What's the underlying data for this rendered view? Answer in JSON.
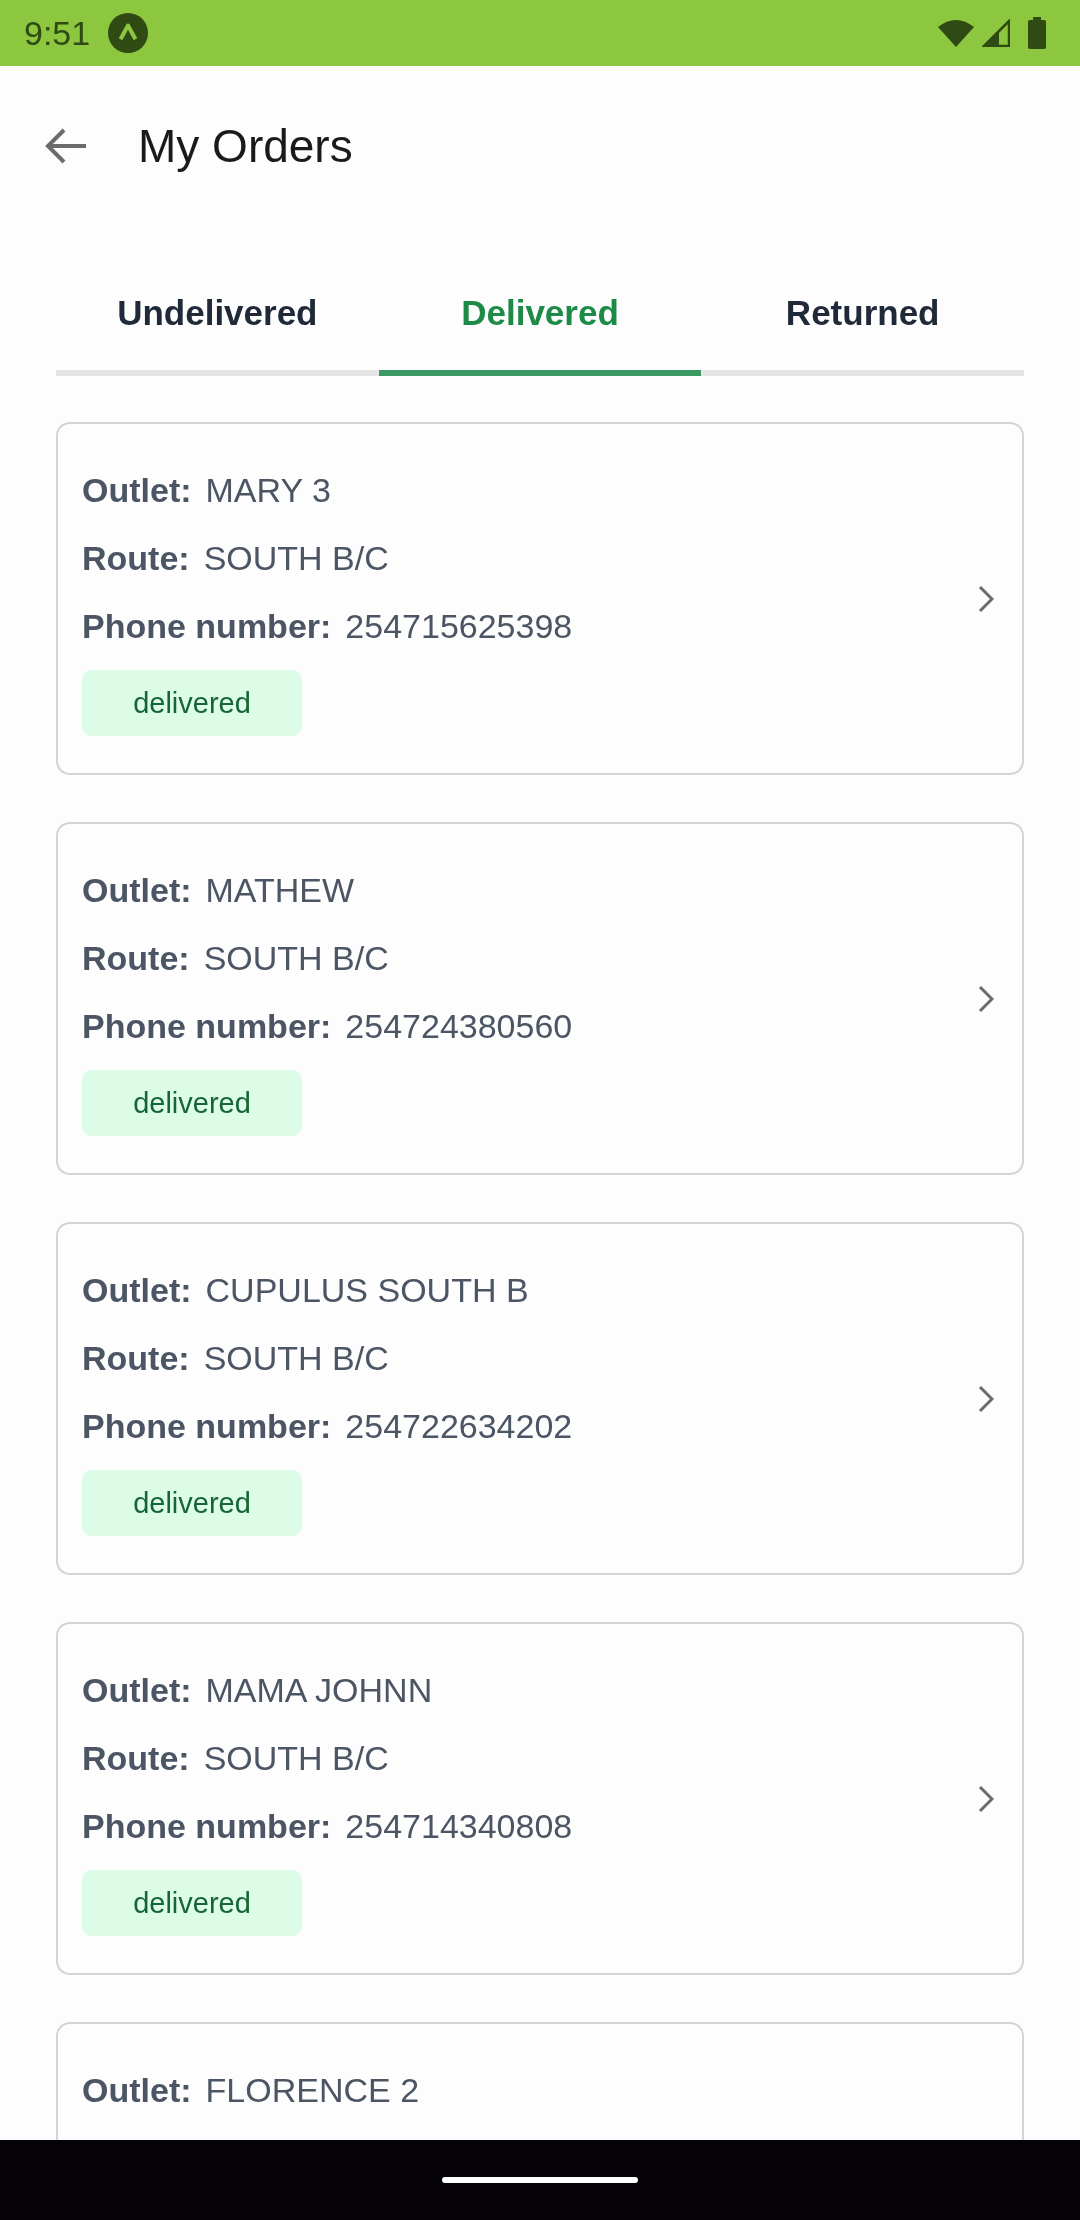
{
  "status_bar": {
    "time": "9:51"
  },
  "header": {
    "title": "My Orders"
  },
  "tabs": [
    {
      "label": "Undelivered",
      "selected": false
    },
    {
      "label": "Delivered",
      "selected": true
    },
    {
      "label": "Returned",
      "selected": false
    }
  ],
  "orders": [
    {
      "fields": [
        {
          "label": "Outlet:",
          "value": "MARY 3"
        },
        {
          "label": "Route:",
          "value": "SOUTH B/C"
        },
        {
          "label": "Phone number:",
          "value": "254715625398"
        }
      ],
      "status": "delivered"
    },
    {
      "fields": [
        {
          "label": "Outlet:",
          "value": "MATHEW"
        },
        {
          "label": "Route:",
          "value": "SOUTH B/C"
        },
        {
          "label": "Phone number:",
          "value": "254724380560"
        }
      ],
      "status": "delivered"
    },
    {
      "fields": [
        {
          "label": "Outlet:",
          "value": "CUPULUS SOUTH B"
        },
        {
          "label": "Route:",
          "value": "SOUTH B/C"
        },
        {
          "label": "Phone number:",
          "value": "254722634202"
        }
      ],
      "status": "delivered"
    },
    {
      "fields": [
        {
          "label": "Outlet:",
          "value": "MAMA JOHNN"
        },
        {
          "label": "Route:",
          "value": "SOUTH B/C"
        },
        {
          "label": "Phone number:",
          "value": "254714340808"
        }
      ],
      "status": "delivered"
    },
    {
      "fields": [
        {
          "label": "Outlet:",
          "value": "FLORENCE 2"
        }
      ]
    }
  ]
}
